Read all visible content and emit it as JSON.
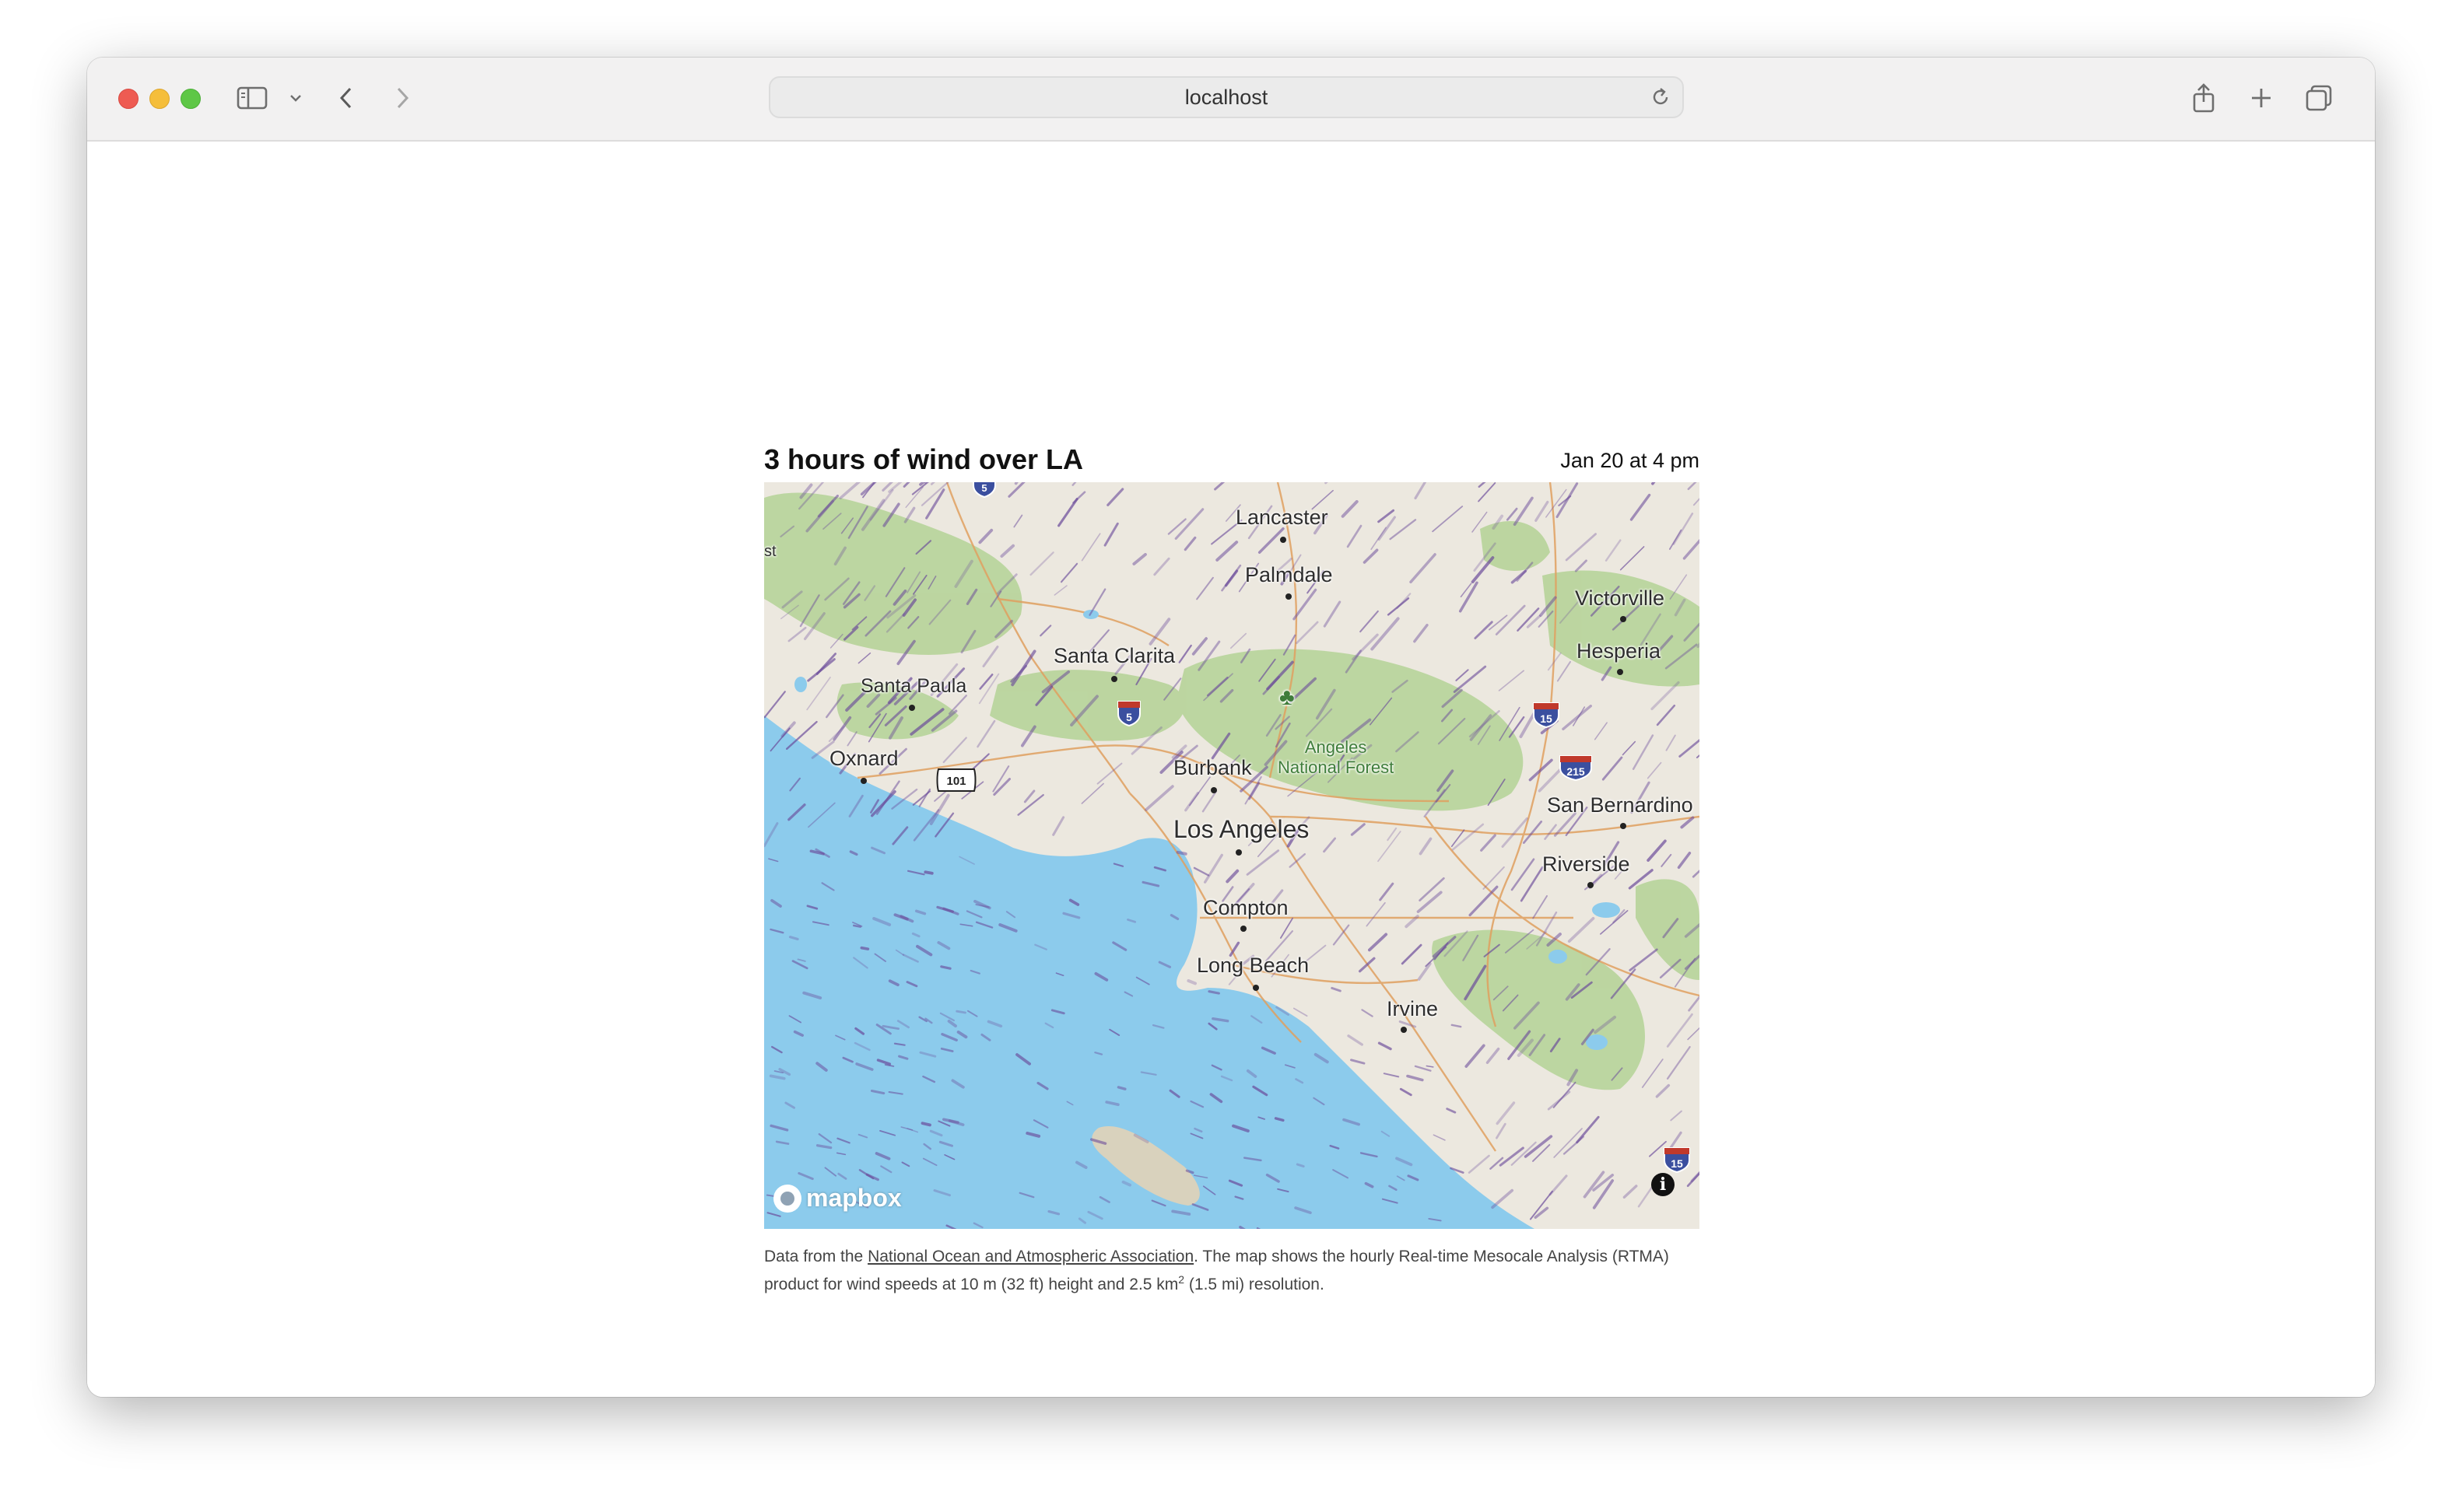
{
  "browser": {
    "address": "localhost",
    "icons": {
      "sidebar": "sidebar-icon",
      "chevron": "chevron-down-icon",
      "back": "back-arrow-icon",
      "forward": "forward-arrow-icon",
      "reload": "reload-icon",
      "share": "share-icon",
      "new_tab": "plus-icon",
      "tabs": "tab-overview-icon"
    }
  },
  "article": {
    "title": "3 hours of wind over LA",
    "timestamp": "Jan 20 at 4 pm"
  },
  "map": {
    "cities": {
      "lancaster": "Lancaster",
      "palmdale": "Palmdale",
      "victorville": "Victorville",
      "hesperia": "Hesperia",
      "santa_clarita": "Santa Clarita",
      "santa_paula": "Santa Paula",
      "oxnard": "Oxnard",
      "burbank": "Burbank",
      "forest_line1": "Angeles",
      "forest_line2": "National Forest",
      "san_bernardino": "San Bernardino",
      "los_angeles": "Los Angeles",
      "riverside": "Riverside",
      "compton": "Compton",
      "long_beach": "Long Beach",
      "irvine": "Irvine",
      "edge": "st"
    },
    "shields": {
      "i5_top": "5",
      "i5": "5",
      "us101": "101",
      "i15": "15",
      "i215": "215",
      "i15_bottom": "15"
    },
    "attribution": "mapbox",
    "info": "i",
    "colors": {
      "water": "#8ccbec",
      "land": "#ece8df",
      "vegetation": "#b7d49a",
      "wind": "#6a4a9a",
      "roads": "#e0a060"
    }
  },
  "caption": {
    "prefix": "Data from the ",
    "link": "National Ocean and Atmospheric Association",
    "middle": ". The map shows the hourly Real-time Mesocale Analysis (RTMA) product for wind speeds at 10 m (32 ft) height and 2.5 km",
    "sup": "2",
    "suffix": " (1.5 mi) resolution."
  }
}
